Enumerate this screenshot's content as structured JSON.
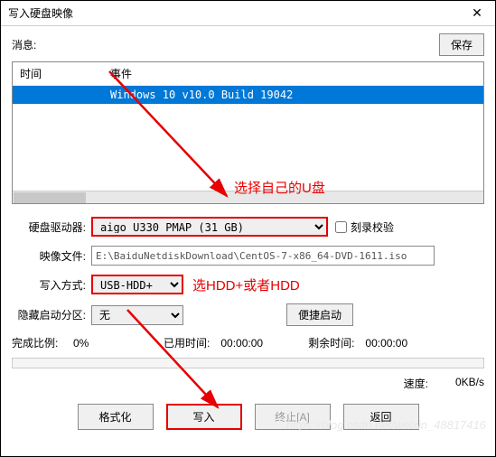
{
  "window": {
    "title": "写入硬盘映像"
  },
  "msg": {
    "label": "消息:",
    "save_btn": "保存"
  },
  "events": {
    "col_time": "时间",
    "col_event": "事件",
    "rows": [
      {
        "time": "",
        "event": "Windows 10 v10.0 Build 19042"
      }
    ]
  },
  "annotations": {
    "select_usb": "选择自己的U盘",
    "select_mode": "选HDD+或者HDD"
  },
  "form": {
    "disk_label": "硬盘驱动器:",
    "disk_value": "aigo   U330         PMAP (31 GB)",
    "verify_label": "刻录校验",
    "file_label": "映像文件:",
    "file_value": "E:\\BaiduNetdiskDownload\\CentOS-7-x86_64-DVD-1611.iso",
    "mode_label": "写入方式:",
    "mode_value": "USB-HDD+",
    "hide_label": "隐藏启动分区:",
    "hide_value": "无",
    "convenient_btn": "便捷启动"
  },
  "progress": {
    "done_label": "完成比例:",
    "done_value": "0%",
    "elapsed_label": "已用时间:",
    "elapsed_value": "00:00:00",
    "remain_label": "剩余时间:",
    "remain_value": "00:00:00",
    "speed_label": "速度:",
    "speed_value": "0KB/s"
  },
  "buttons": {
    "format": "格式化",
    "write": "写入",
    "stop": "终止[A]",
    "back": "返回"
  },
  "watermark": "https://blog.csdn.net/weixin_48817416"
}
